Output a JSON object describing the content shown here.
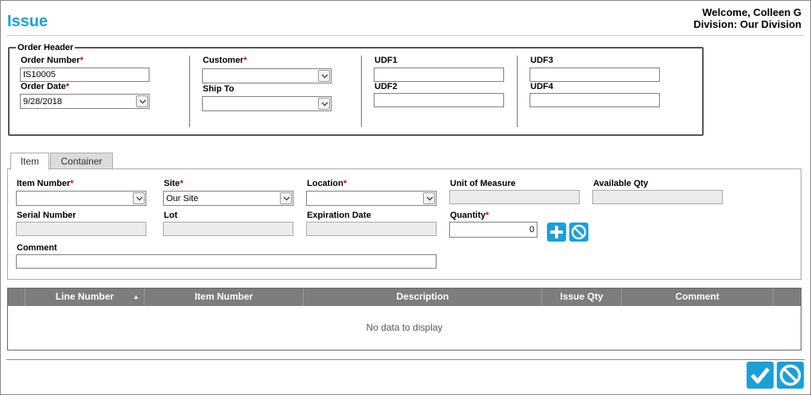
{
  "page": {
    "title": "Issue",
    "welcome": "Welcome, Colleen G",
    "division": "Division: Our Division"
  },
  "order_header": {
    "legend": "Order Header",
    "order_number_label": "Order Number",
    "order_number_value": "IS10005",
    "order_date_label": "Order Date",
    "order_date_value": "9/28/2018",
    "customer_label": "Customer",
    "customer_value": "",
    "ship_to_label": "Ship To",
    "ship_to_value": "",
    "udf1_label": "UDF1",
    "udf2_label": "UDF2",
    "udf3_label": "UDF3",
    "udf4_label": "UDF4",
    "required_mark": "*"
  },
  "tabs": [
    {
      "label": "Item",
      "active": true
    },
    {
      "label": "Container",
      "active": false
    }
  ],
  "item_form": {
    "item_number_label": "Item Number",
    "site_label": "Site",
    "site_value": "Our Site",
    "location_label": "Location",
    "uom_label": "Unit of Measure",
    "available_qty_label": "Available Qty",
    "serial_number_label": "Serial Number",
    "lot_label": "Lot",
    "expiration_date_label": "Expiration Date",
    "quantity_label": "Quantity",
    "quantity_value": "0",
    "comment_label": "Comment"
  },
  "grid": {
    "columns": [
      "Line Number",
      "Item Number",
      "Description",
      "Issue Qty",
      "Comment"
    ],
    "sort_indicator": "▲",
    "empty_text": "No data to display"
  },
  "colors": {
    "accent": "#1aa0d8",
    "header_gray": "#7d7d7d",
    "required": "#dd0000"
  },
  "icons": {
    "add": "plus-icon",
    "cancel": "cancel-icon",
    "confirm": "checkmark-icon",
    "dropdown": "chevron-down-icon"
  }
}
